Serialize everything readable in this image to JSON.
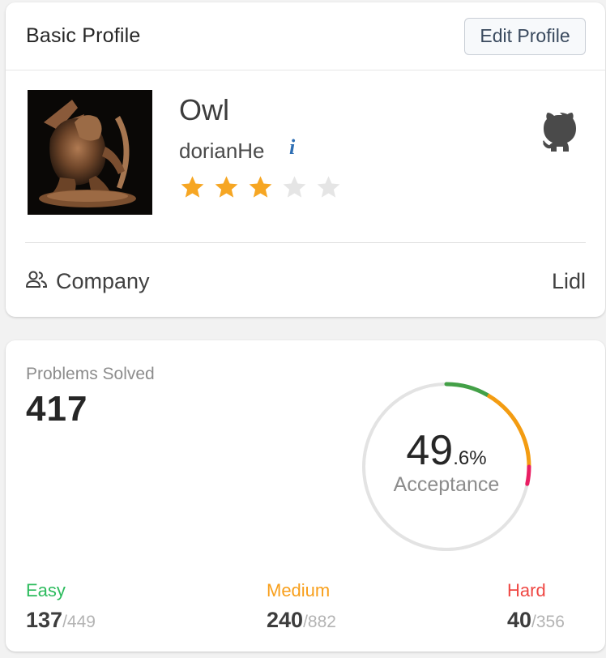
{
  "profile": {
    "title": "Basic Profile",
    "edit_label": "Edit Profile",
    "name": "Owl",
    "username": "dorianHe",
    "info_icon": "i",
    "rating": {
      "filled": 3,
      "max": 5
    },
    "company_label": "Company",
    "company_value": "Lidl",
    "colors": {
      "star_filled": "#f6a623",
      "star_empty": "#e5e5e5",
      "info": "#2e6fb4"
    }
  },
  "stats": {
    "label": "Problems Solved",
    "count": "417",
    "acceptance_int": "49",
    "acceptance_dec": ".6%",
    "acceptance_label": "Acceptance",
    "difficulties": [
      {
        "label": "Easy",
        "solved": "137",
        "total": "/449",
        "color": "#2cbb5d"
      },
      {
        "label": "Medium",
        "solved": "240",
        "total": "/882",
        "color": "#f89f1b"
      },
      {
        "label": "Hard",
        "solved": "40",
        "total": "/356",
        "color": "#ef4743"
      }
    ],
    "ring_colors": {
      "track": "#e3e3e3",
      "easy": "#43a047",
      "medium": "#f39c12",
      "hard": "#e91e63"
    }
  }
}
